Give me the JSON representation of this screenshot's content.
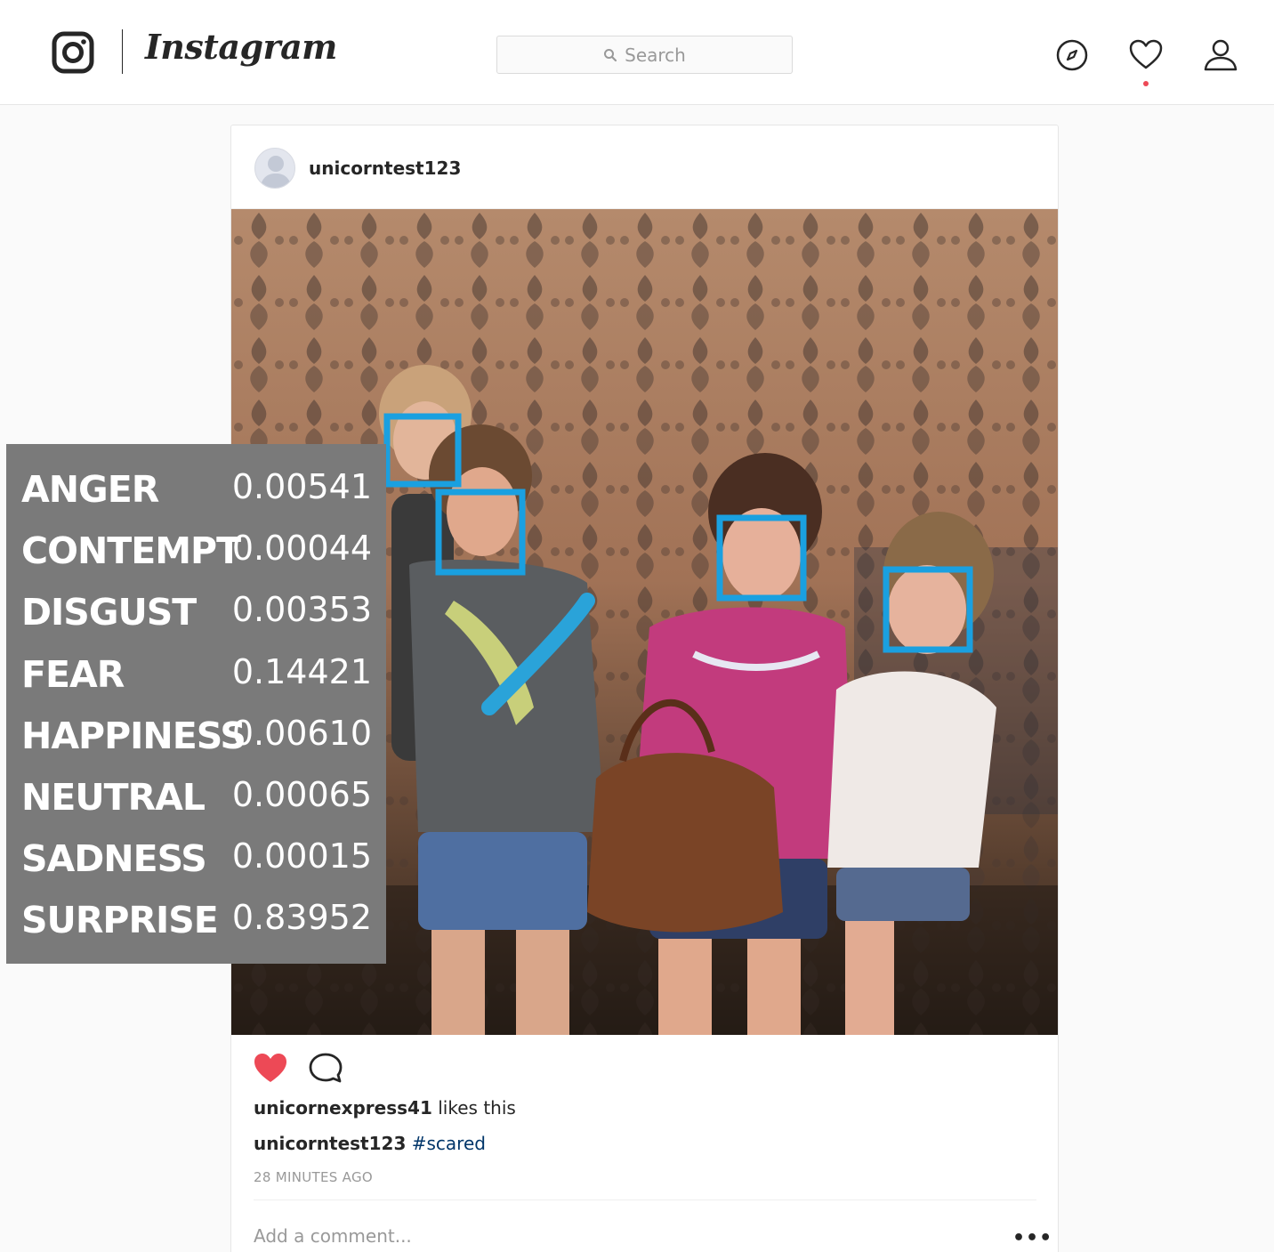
{
  "header": {
    "logo_icon": "camera-outline-icon",
    "wordmark": "Instagram",
    "search": {
      "icon": "search-icon",
      "placeholder": "Search"
    },
    "nav_icons": [
      "compass-icon",
      "heart-outline-icon",
      "user-icon"
    ],
    "notification_dot_color": "#ed4956"
  },
  "post": {
    "author": "unicorntest123",
    "image_description_icon": "photo",
    "face_box_color": "#1aa0e0",
    "face_count": 4,
    "actions": {
      "like_icon": "heart-filled-icon",
      "like_color": "#ed4956",
      "comment_icon": "comment-bubble-icon"
    },
    "likes": {
      "user": "unicornexpress41",
      "suffix": " likes this"
    },
    "caption": {
      "user": "unicorntest123",
      "hashtag": "#scared"
    },
    "time_ago": "28 MINUTES AGO",
    "comment_placeholder": "Add a comment...",
    "more_label": "•••"
  },
  "emotions": [
    {
      "label": "ANGER",
      "value": "0.00541"
    },
    {
      "label": "CONTEMPT",
      "value": "0.00044"
    },
    {
      "label": "DISGUST",
      "value": "0.00353"
    },
    {
      "label": "FEAR",
      "value": "0.14421"
    },
    {
      "label": "HAPPINESS",
      "value": "0.00610"
    },
    {
      "label": "NEUTRAL",
      "value": "0.00065"
    },
    {
      "label": "SADNESS",
      "value": "0.00015"
    },
    {
      "label": "SURPRISE",
      "value": "0.83952"
    }
  ]
}
